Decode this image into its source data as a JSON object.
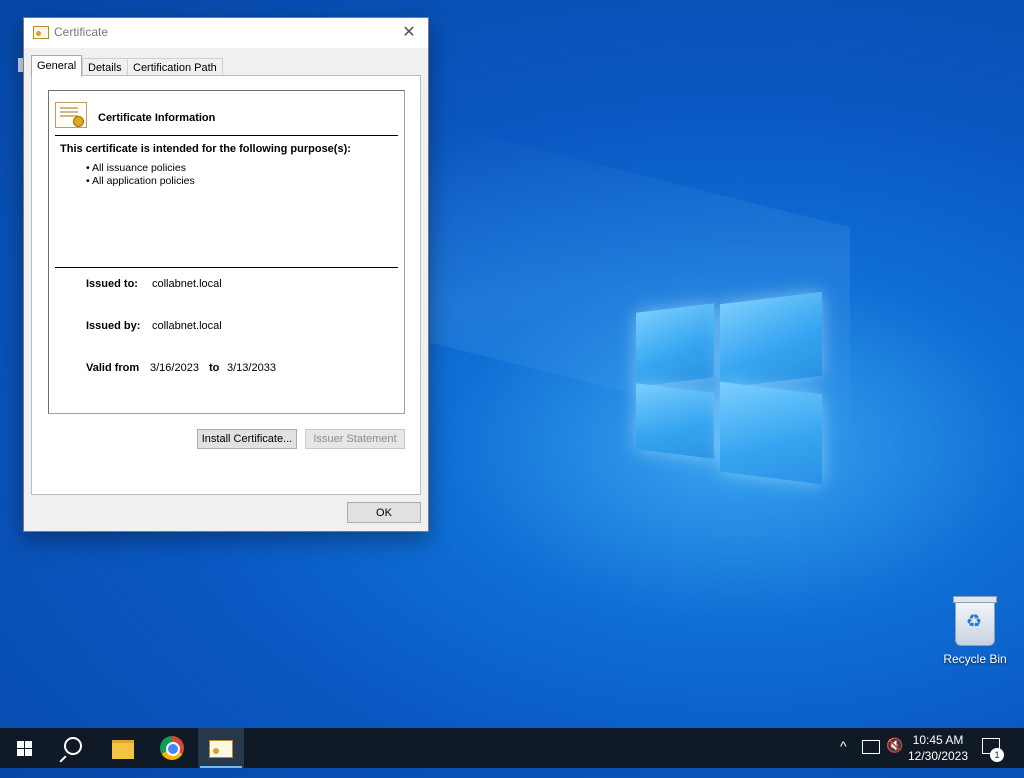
{
  "dialog": {
    "title": "Certificate",
    "tabs": [
      {
        "label": "General",
        "active": true
      },
      {
        "label": "Details",
        "active": false
      },
      {
        "label": "Certification Path",
        "active": false
      }
    ],
    "info_title": "Certificate Information",
    "purpose_heading": "This certificate is intended for the following purpose(s):",
    "purposes": [
      "• All issuance policies",
      "• All application policies"
    ],
    "issued_to_label": "Issued to:",
    "issued_to": "collabnet.local",
    "issued_by_label": "Issued by:",
    "issued_by": "collabnet.local",
    "valid_from_label": "Valid from",
    "valid_from": "3/16/2023",
    "to_label": "to",
    "valid_to": "3/13/2033",
    "install_button": "Install Certificate...",
    "issuer_statement_button": "Issuer Statement",
    "ok_button": "OK",
    "close_glyph": "✕"
  },
  "desktop": {
    "recycle_bin_label": "Recycle Bin"
  },
  "taskbar": {
    "time": "10:45 AM",
    "date": "12/30/2023",
    "notification_count": "1",
    "tray_chevron": "^",
    "volume_glyph": "🔇"
  },
  "colors": {
    "desktop_blue": "#0a57c2",
    "taskbar": "#101a26",
    "active_indicator": "#76b9ed"
  }
}
